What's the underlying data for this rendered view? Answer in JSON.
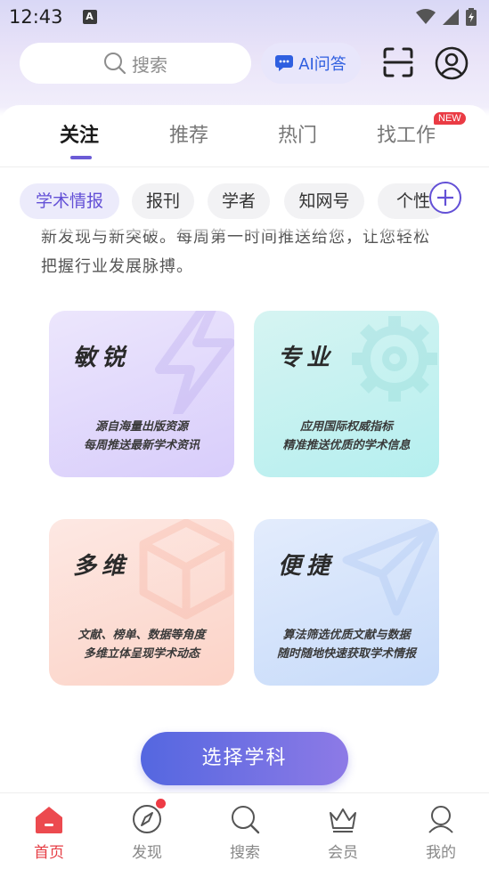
{
  "status_bar": {
    "time": "12:43",
    "notification_icon": "a-icon",
    "icons": [
      "wifi-icon",
      "signal-icon",
      "battery-icon"
    ]
  },
  "search": {
    "placeholder": "搜索"
  },
  "ai_button": {
    "label": "AI问答"
  },
  "tabs": [
    {
      "label": "关注",
      "active": true
    },
    {
      "label": "推荐",
      "active": false
    },
    {
      "label": "热门",
      "active": false
    },
    {
      "label": "找工作",
      "active": false,
      "badge": "NEW"
    }
  ],
  "chips": [
    {
      "label": "学术情报",
      "active": true
    },
    {
      "label": "报刊",
      "active": false
    },
    {
      "label": "学者",
      "active": false
    },
    {
      "label": "知网号",
      "active": false
    },
    {
      "label": "个性",
      "active": false
    }
  ],
  "intro": {
    "line1": "新发现与新突破。每周第一时间推送给您，让您轻松",
    "line2": "把握行业发展脉搏。"
  },
  "features": [
    {
      "title": "敏锐",
      "line1": "源自海量出版资源",
      "line2": "每周推送最新学术资讯",
      "icon": "lightning-icon"
    },
    {
      "title": "专业",
      "line1": "应用国际权威指标",
      "line2": "精准推送优质的学术信息",
      "icon": "gear-icon"
    },
    {
      "title": "多维",
      "line1": "文献、榜单、数据等角度",
      "line2": "多维立体呈现学术动态",
      "icon": "cube-icon"
    },
    {
      "title": "便捷",
      "line1": "算法筛选优质文献与数据",
      "line2": "随时随地快速获取学术情报",
      "icon": "paper-plane-icon"
    }
  ],
  "choose_button": {
    "label": "选择学科"
  },
  "bottom_nav": [
    {
      "label": "首页",
      "icon": "home-icon",
      "active": true
    },
    {
      "label": "发现",
      "icon": "compass-icon",
      "active": false
    },
    {
      "label": "搜索",
      "icon": "search-icon",
      "active": false
    },
    {
      "label": "会员",
      "icon": "crown-icon",
      "active": false
    },
    {
      "label": "我的",
      "icon": "person-icon",
      "active": false
    }
  ],
  "colors": {
    "accent": "#6350d6",
    "nav_active": "#e63d44",
    "ai_blue": "#2f5fe0"
  }
}
